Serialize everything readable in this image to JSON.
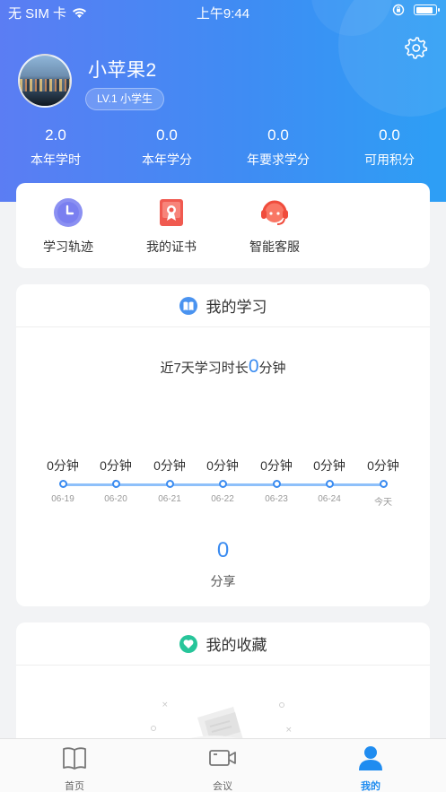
{
  "status_bar": {
    "carrier": "无 SIM 卡",
    "time": "上午9:44"
  },
  "profile": {
    "name": "小苹果2",
    "level": "LV.1 小学生"
  },
  "stats": [
    {
      "value": "2.0",
      "label": "本年学时"
    },
    {
      "value": "0.0",
      "label": "本年学分"
    },
    {
      "value": "0.0",
      "label": "年要求学分"
    },
    {
      "value": "0.0",
      "label": "可用积分"
    }
  ],
  "quick_actions": [
    {
      "label": "学习轨迹",
      "icon": "clock-icon",
      "color": "#7b83f0"
    },
    {
      "label": "我的证书",
      "icon": "certificate-icon",
      "color": "#f2554f"
    },
    {
      "label": "智能客服",
      "icon": "headset-icon",
      "color": "#f25a4a"
    }
  ],
  "study": {
    "title": "我的学习",
    "recent_prefix": "近7天学习时长",
    "recent_value": "0",
    "recent_unit": "分钟",
    "days": [
      {
        "value": "0分钟",
        "date": "06-19"
      },
      {
        "value": "0分钟",
        "date": "06-20"
      },
      {
        "value": "0分钟",
        "date": "06-21"
      },
      {
        "value": "0分钟",
        "date": "06-22"
      },
      {
        "value": "0分钟",
        "date": "06-23"
      },
      {
        "value": "0分钟",
        "date": "06-24"
      },
      {
        "value": "0分钟",
        "date": "今天"
      }
    ],
    "share_count": "0",
    "share_label": "分享"
  },
  "favorites": {
    "title": "我的收藏"
  },
  "tabbar": [
    {
      "label": "首页",
      "icon": "book-icon",
      "active": false
    },
    {
      "label": "会议",
      "icon": "video-camera-icon",
      "active": false
    },
    {
      "label": "我的",
      "icon": "user-icon",
      "active": true
    }
  ],
  "colors": {
    "accent": "#3a8bf0",
    "header_start": "#5b7df3",
    "header_end": "#2d9ff5",
    "active_tab": "#1f8cf0"
  }
}
